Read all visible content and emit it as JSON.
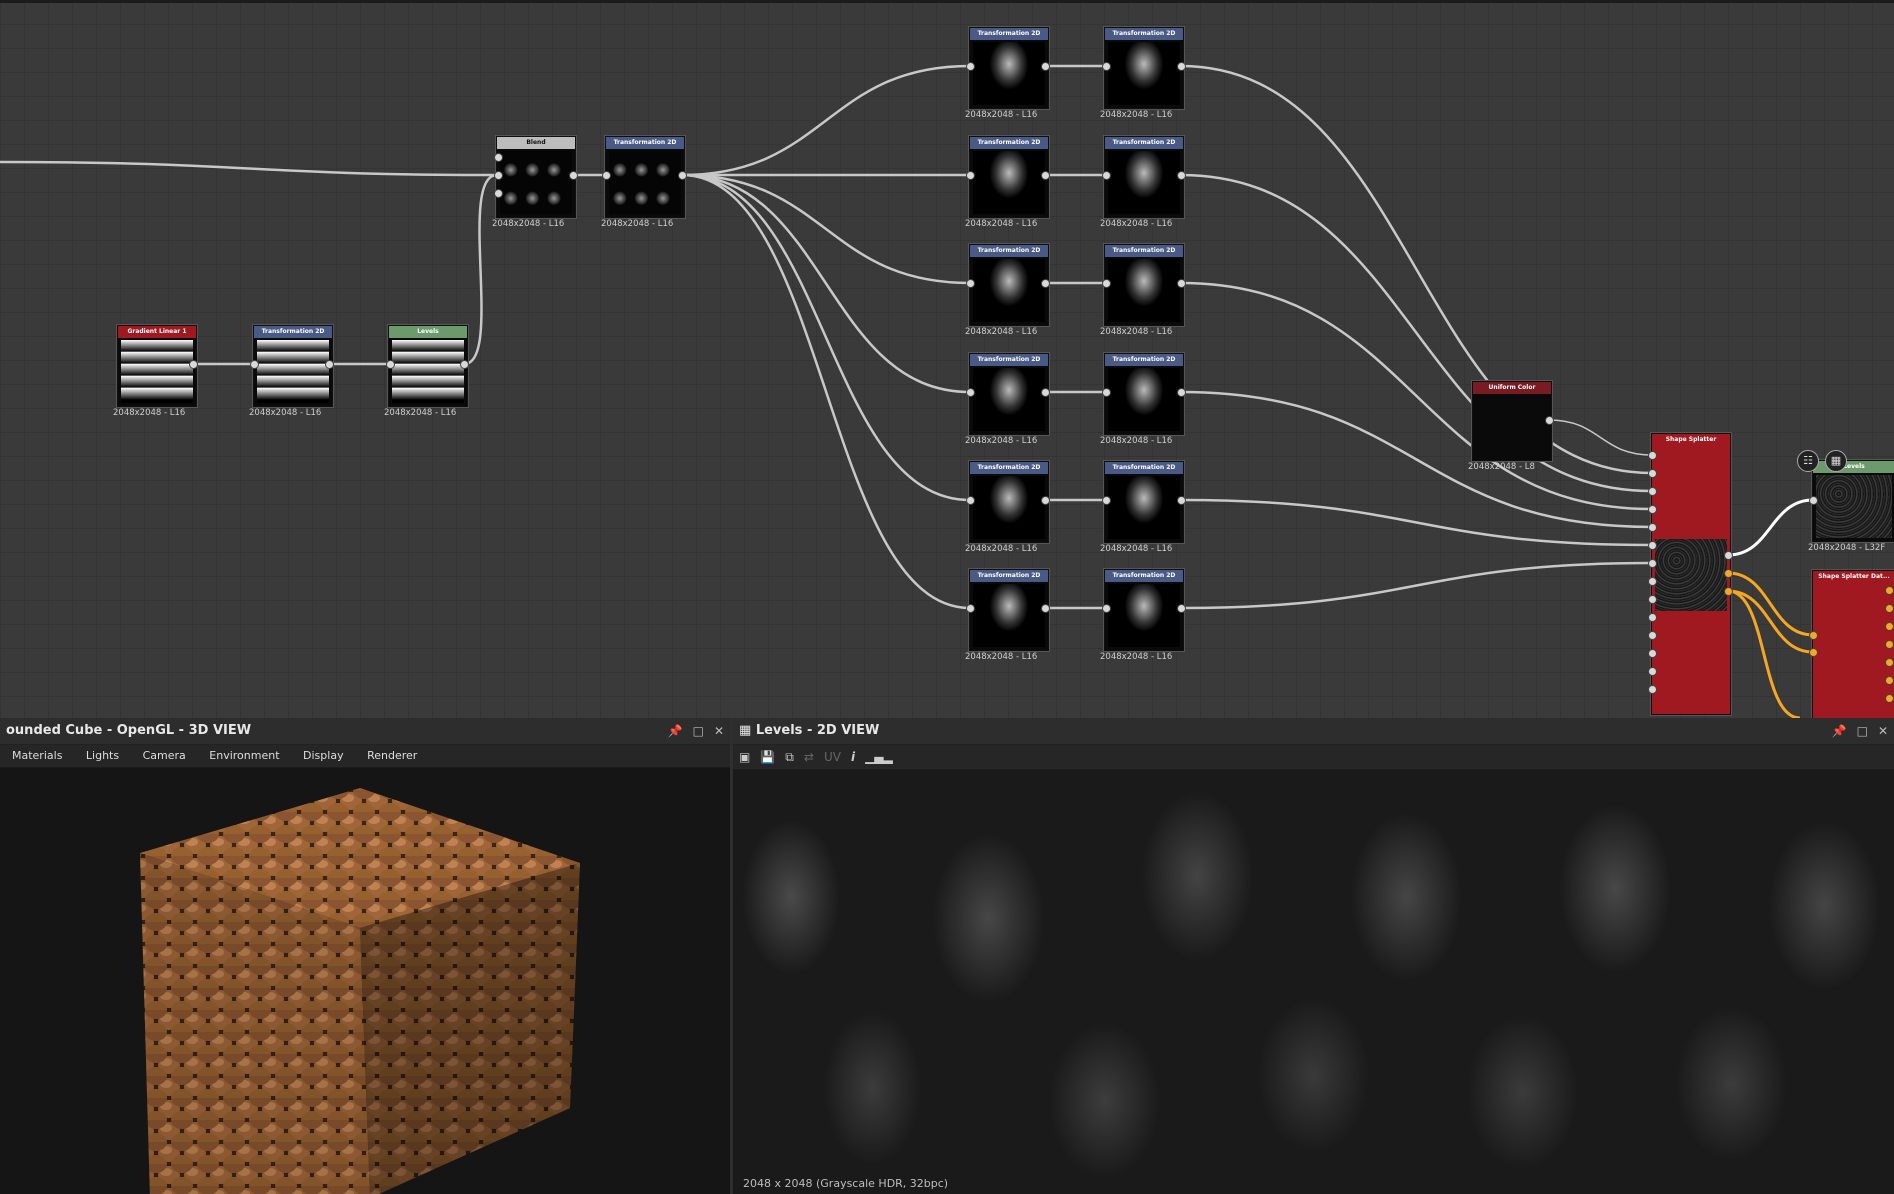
{
  "graph": {
    "resolution_label": "2048x2048 - L16",
    "nodes": {
      "gradient": {
        "title": "Gradient Linear 1",
        "color": "#a01820",
        "label": "2048x2048 - L16"
      },
      "transform_a": {
        "title": "Transformation 2D",
        "color": "#4a5a86",
        "label": "2048x2048 - L16"
      },
      "levels_a": {
        "title": "Levels",
        "color": "#6d9a6d",
        "label": "2048x2048 - L16"
      },
      "blend": {
        "title": "Blend",
        "color": "#bdbdbd",
        "label": "2048x2048 - L16"
      },
      "transform_b": {
        "title": "Transformation 2D",
        "color": "#4a5a86",
        "label": "2048x2048 - L16"
      },
      "uniform_color": {
        "title": "Uniform Color",
        "color": "#7a1a22",
        "label": "2048x2048 - L8"
      },
      "shape_splatter": {
        "title": "Shape Splatter",
        "color": "#a01820",
        "label": "2048x2048 - L32F"
      },
      "levels_b": {
        "title": "Levels",
        "color": "#6d9a6d",
        "label": "2048x2048 - L32F"
      },
      "shape_splatter_data": {
        "title": "Shape Splatter Dat...",
        "color": "#a01820"
      }
    },
    "transform_grid_title": "Transformation 2D",
    "transform_grid_label": "2048x2048 - L16"
  },
  "panel3d": {
    "title": "ounded Cube - OpenGL - 3D VIEW",
    "menu": [
      "Materials",
      "Lights",
      "Camera",
      "Environment",
      "Display",
      "Renderer"
    ]
  },
  "panel2d": {
    "title": "Levels - 2D VIEW",
    "uv_label": "UV",
    "status": "2048 x 2048 (Grayscale HDR, 32bpc)"
  },
  "icons": {
    "pin": "pin-icon",
    "float": "float-icon",
    "close": "close-icon"
  }
}
